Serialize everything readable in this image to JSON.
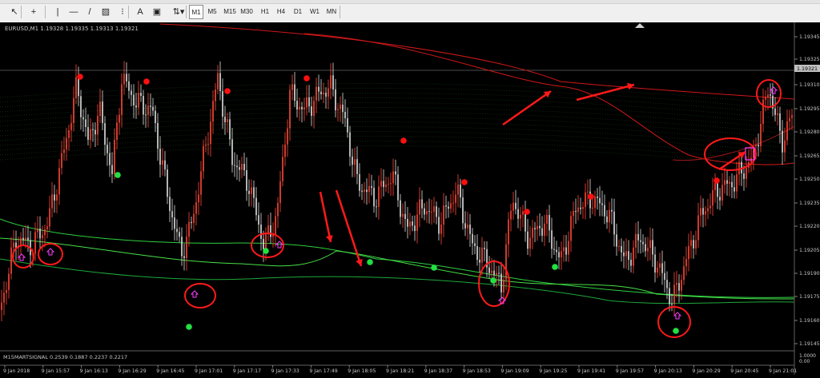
{
  "toolbar": {
    "timeframes": [
      "M1",
      "M5",
      "M15",
      "M30",
      "H1",
      "H4",
      "D1",
      "W1",
      "MN"
    ],
    "active_timeframe": "M1",
    "tools": [
      {
        "name": "cursor-icon",
        "glyph": "↖"
      },
      {
        "name": "crosshair-icon",
        "glyph": "+"
      },
      {
        "name": "vertical-line-icon",
        "glyph": "|"
      },
      {
        "name": "horizontal-line-icon",
        "glyph": "—"
      },
      {
        "name": "trendline-icon",
        "glyph": "/"
      },
      {
        "name": "equidistant-channel-icon",
        "glyph": "▨"
      },
      {
        "name": "fibonacci-icon",
        "glyph": "⁝"
      },
      {
        "name": "text-icon",
        "glyph": "A"
      },
      {
        "name": "text-label-icon",
        "glyph": "▣"
      },
      {
        "name": "arrows-icon",
        "glyph": "⇅▾"
      }
    ]
  },
  "chart": {
    "header": "EURUSD,M1  1.19328 1.19335 1.19313 1.19321",
    "price_labels": [
      "1.19345",
      "1.19325",
      "1.19310",
      "1.19295",
      "1.19280",
      "1.19265",
      "1.19250",
      "1.19235",
      "1.19220",
      "1.19205",
      "1.19190",
      "1.19175",
      "1.19160",
      "1.19145"
    ],
    "current_price": "1.19321",
    "time_labels": [
      "9 Jan 2018",
      "9 Jan 15:57",
      "9 Jan 16:13",
      "9 Jan 16:29",
      "9 Jan 16:45",
      "9 Jan 17:01",
      "9 Jan 17:17",
      "9 Jan 17:33",
      "9 Jan 17:49",
      "9 Jan 18:05",
      "9 Jan 18:21",
      "9 Jan 18:37",
      "9 Jan 18:53",
      "9 Jan 19:09",
      "9 Jan 19:25",
      "9 Jan 19:41",
      "9 Jan 19:57",
      "9 Jan 20:13",
      "9 Jan 20:29",
      "9 Jan 20:45",
      "9 Jan 21:01"
    ],
    "indicator_header": "M15MARTSIGNAL 0.2539 0.1887 0.2237 0.2217",
    "sub_scale_labels": [
      "1.0000",
      "0.00"
    ],
    "colors": {
      "bull": "#ff4a3a",
      "bear": "#e0e0e0",
      "sell_dot": "#ff1010",
      "buy_dot": "#22e040",
      "red_band": "#d01818",
      "green_band": "#2fd040",
      "annotation": "#ff1a1a",
      "arrow_signal": "#ff3cff"
    }
  }
}
